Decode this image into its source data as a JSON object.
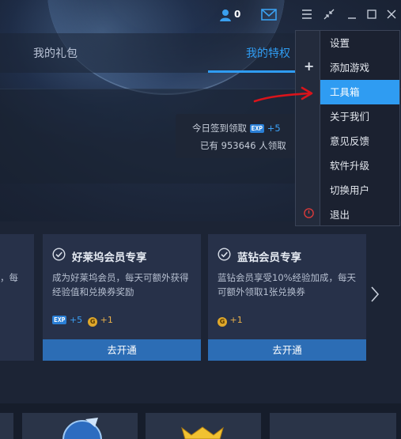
{
  "titlebar": {
    "user_count": "0"
  },
  "tabs": [
    {
      "label": "我的礼包"
    },
    {
      "label": "我的特权"
    }
  ],
  "signin": {
    "line1_prefix": "今日签到领取",
    "exp_badge": "EXP",
    "line1_bonus": "+5",
    "line2": "已有 953646 人领取"
  },
  "cards": {
    "partial_line1": "，每",
    "partial_line2": "",
    "a": {
      "title": "好莱坞会员专享",
      "desc": "成为好莱坞会员，每天可额外获得经验值和兑换券奖励",
      "exp_badge": "EXP",
      "exp_bonus": "+5",
      "coin_icon": "G",
      "coin_bonus": "+1",
      "button": "去开通"
    },
    "b": {
      "title": "蓝钻会员专享",
      "desc": "蓝钻会员享受10%经验加成，每天可额外领取1张兑换券",
      "coin_icon": "G",
      "coin_bonus": "+1",
      "button": "去开通"
    }
  },
  "menu": {
    "plus": "+",
    "items": [
      {
        "label": "设置"
      },
      {
        "label": "添加游戏"
      },
      {
        "label": "工具箱"
      },
      {
        "label": "关于我们"
      },
      {
        "label": "意见反馈"
      },
      {
        "label": "软件升级"
      },
      {
        "label": "切换用户"
      },
      {
        "label": "退出"
      }
    ],
    "active_index": 2
  },
  "colors": {
    "accent": "#2f9cf2",
    "button": "#2c6db5",
    "annotation": "#d9141b"
  }
}
